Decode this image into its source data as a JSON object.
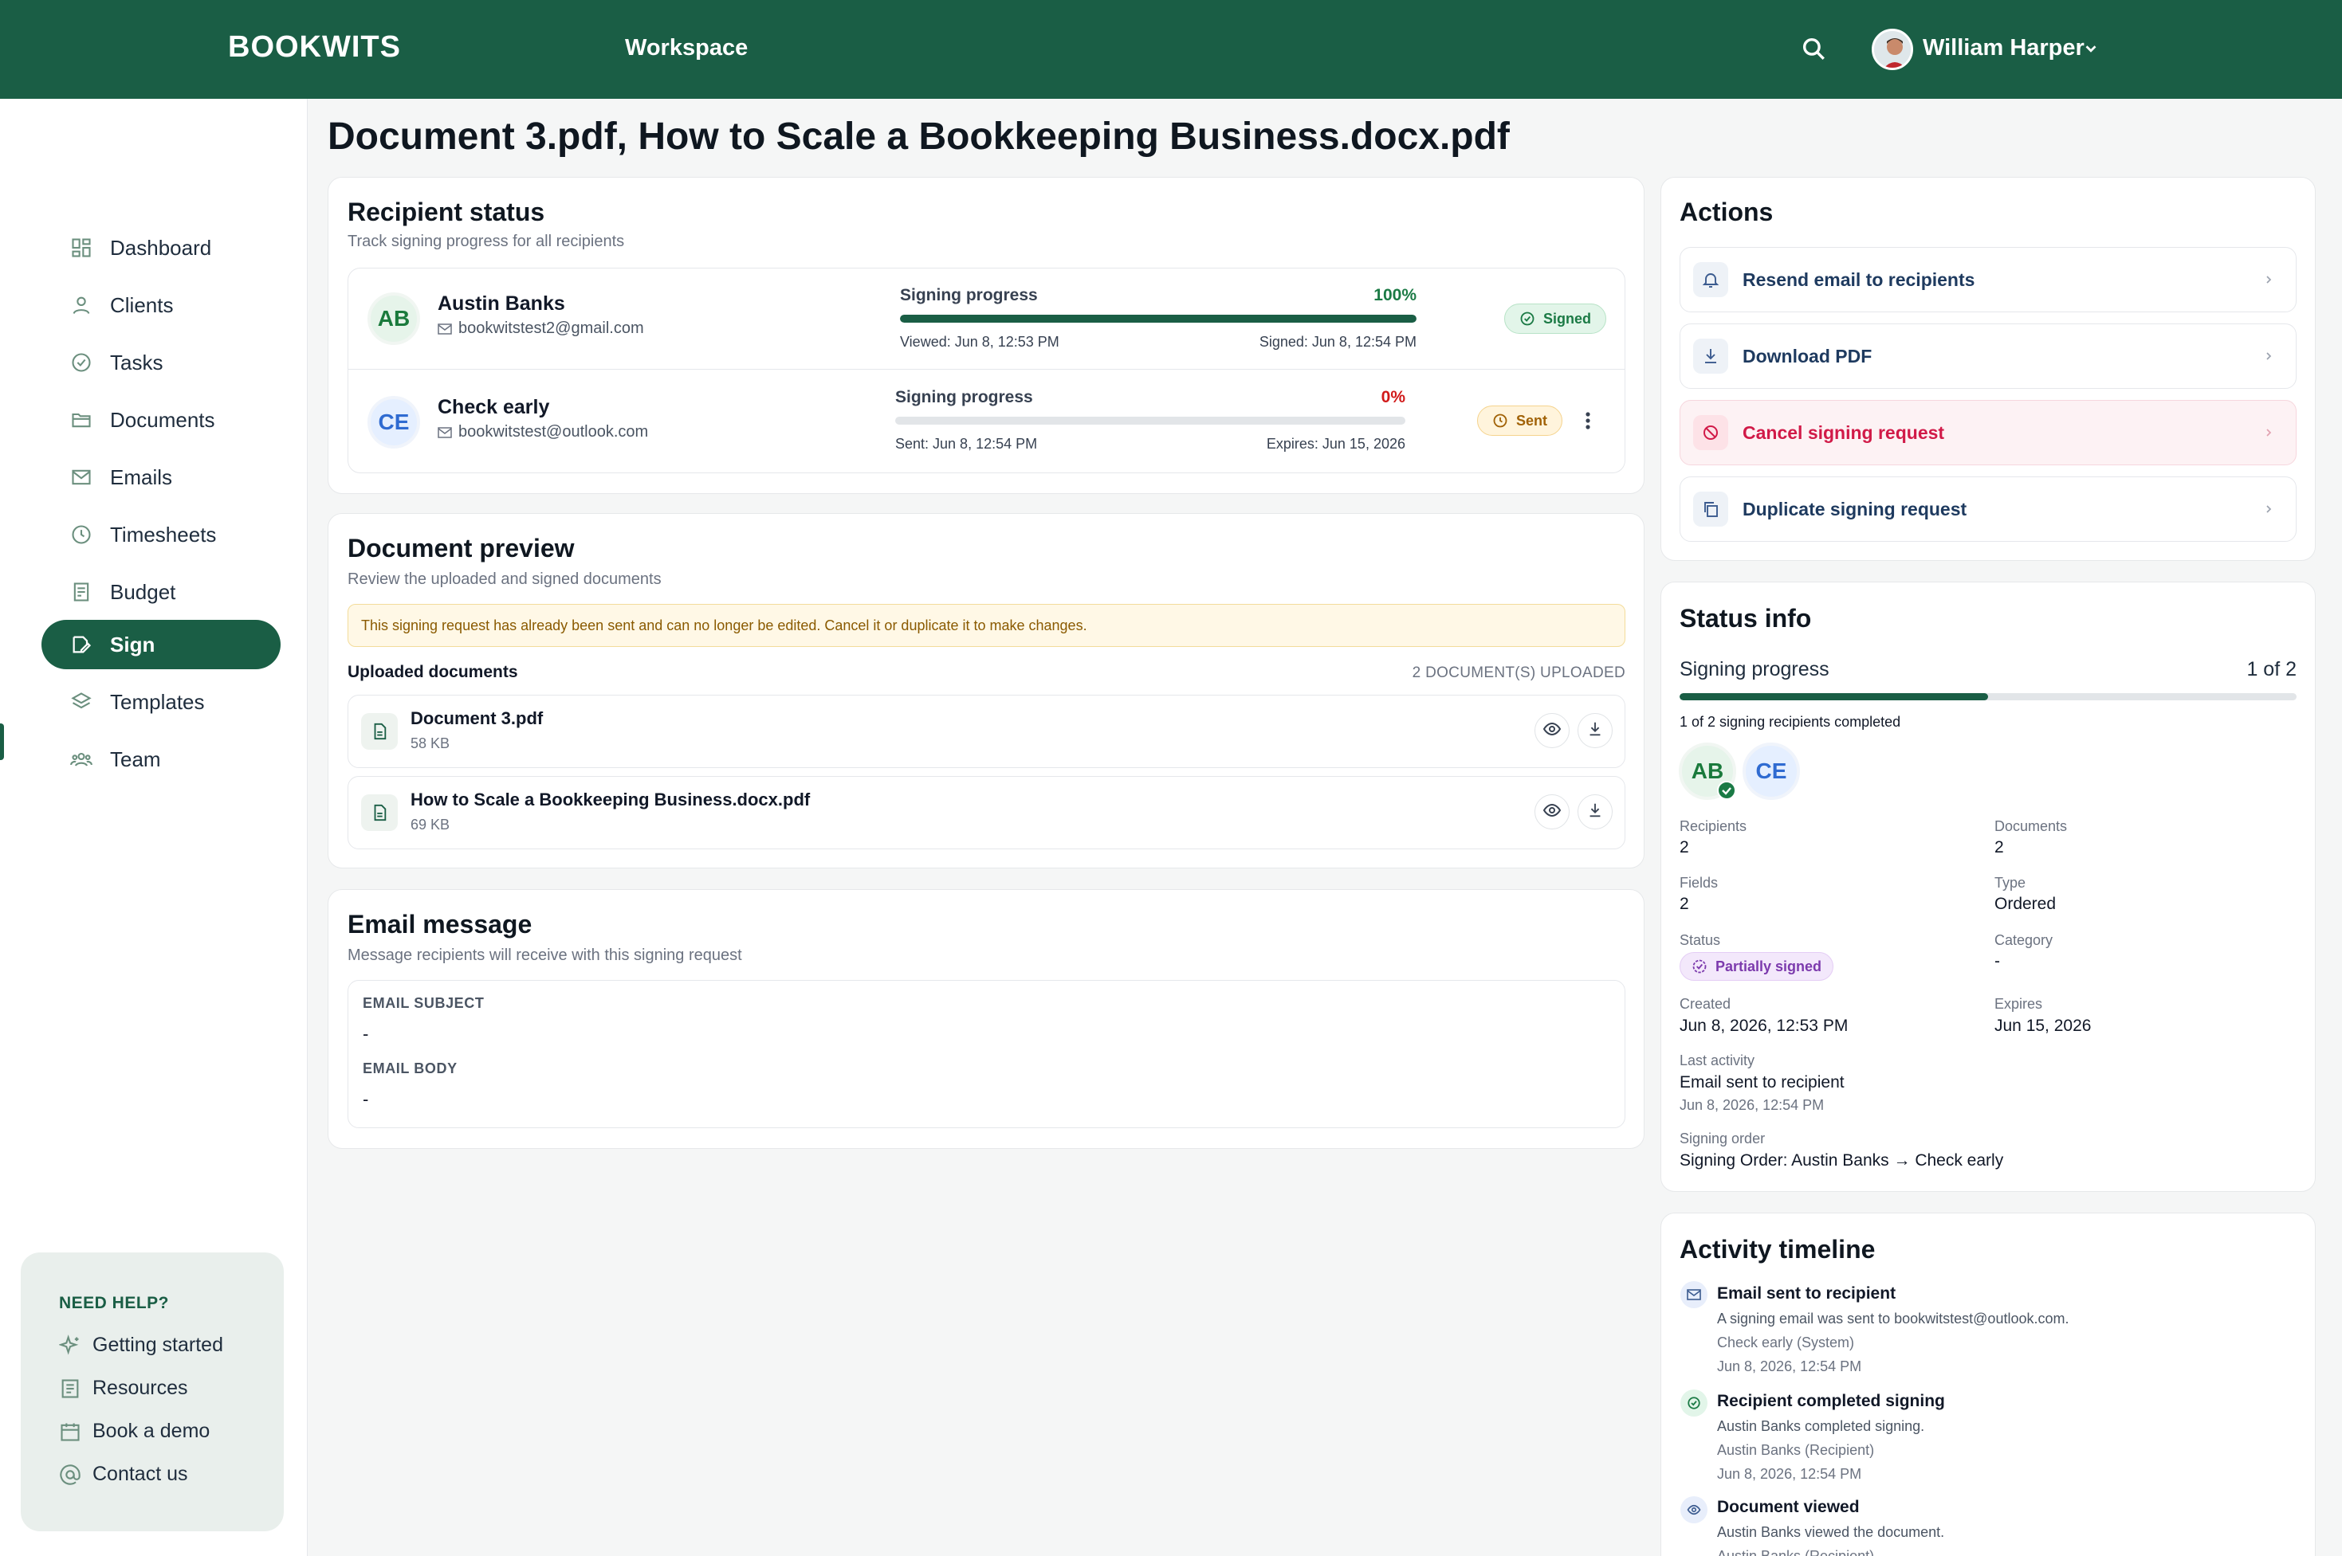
{
  "header": {
    "brand": "BOOKWITS",
    "workspace": "Workspace",
    "user_name": "William Harper"
  },
  "sidebar": {
    "items": [
      {
        "label": "Dashboard",
        "icon": "grid-icon"
      },
      {
        "label": "Clients",
        "icon": "user-icon"
      },
      {
        "label": "Tasks",
        "icon": "check-circle-icon"
      },
      {
        "label": "Documents",
        "icon": "folder-icon"
      },
      {
        "label": "Emails",
        "icon": "mail-icon"
      },
      {
        "label": "Timesheets",
        "icon": "clock-icon"
      },
      {
        "label": "Budget",
        "icon": "receipt-icon"
      },
      {
        "label": "Sign",
        "icon": "signature-icon",
        "active": true
      },
      {
        "label": "Templates",
        "icon": "layers-icon"
      },
      {
        "label": "Team",
        "icon": "team-icon"
      }
    ],
    "help": {
      "title": "NEED HELP?",
      "items": [
        {
          "label": "Getting started",
          "icon": "sparkle-icon"
        },
        {
          "label": "Resources",
          "icon": "book-icon"
        },
        {
          "label": "Book a demo",
          "icon": "calendar-icon"
        },
        {
          "label": "Contact us",
          "icon": "at-icon"
        }
      ]
    }
  },
  "page": {
    "title": "Document 3.pdf, How to Scale a Bookkeeping Business.docx.pdf"
  },
  "recipient_status": {
    "title": "Recipient status",
    "subtitle": "Track signing progress for all recipients",
    "recipients": [
      {
        "initials": "AB",
        "name": "Austin Banks",
        "email": "bookwitstest2@gmail.com",
        "progress_label": "Signing progress",
        "progress_text": "100%",
        "progress": 1.0,
        "meta_left": "Viewed: Jun 8, 12:53 PM",
        "meta_right": "Signed: Jun 8, 12:54 PM",
        "status": "Signed"
      },
      {
        "initials": "CE",
        "name": "Check early",
        "email": "bookwitstest@outlook.com",
        "progress_label": "Signing progress",
        "progress_text": "0%",
        "progress": 0.0,
        "meta_left": "Sent: Jun 8, 12:54 PM",
        "meta_right": "Expires: Jun 15, 2026",
        "status": "Sent"
      }
    ]
  },
  "document_preview": {
    "title": "Document preview",
    "subtitle": "Review the uploaded and signed documents",
    "notice": "This signing request has already been sent and can no longer be edited. Cancel it or duplicate it to make changes.",
    "uploaded_label": "Uploaded documents",
    "uploaded_count": "2 DOCUMENT(S) UPLOADED",
    "documents": [
      {
        "name": "Document 3.pdf",
        "size": "58 KB"
      },
      {
        "name": "How to Scale a Bookkeeping Business.docx.pdf",
        "size": "69 KB"
      }
    ]
  },
  "email_message": {
    "title": "Email message",
    "subtitle": "Message recipients will receive with this signing request",
    "subject_label": "EMAIL SUBJECT",
    "subject_value": "-",
    "body_label": "EMAIL BODY",
    "body_value": "-"
  },
  "actions": {
    "title": "Actions",
    "items": [
      {
        "label": "Resend email to recipients",
        "icon": "bell-icon"
      },
      {
        "label": "Download PDF",
        "icon": "download-icon"
      },
      {
        "label": "Cancel signing request",
        "icon": "ban-icon",
        "danger": true
      },
      {
        "label": "Duplicate signing request",
        "icon": "copy-icon"
      }
    ]
  },
  "status_info": {
    "title": "Status info",
    "progress_label": "Signing progress",
    "progress_count": "1 of 2",
    "progress": 0.5,
    "progress_note": "1 of 2 signing recipients completed",
    "avatars": [
      "AB",
      "CE"
    ],
    "fields": {
      "recipients_label": "Recipients",
      "recipients_value": "2",
      "documents_label": "Documents",
      "documents_value": "2",
      "fields_label": "Fields",
      "fields_value": "2",
      "type_label": "Type",
      "type_value": "Ordered",
      "status_label": "Status",
      "status_value": "Partially signed",
      "category_label": "Category",
      "category_value": "-",
      "created_label": "Created",
      "created_value": "Jun 8, 2026, 12:53 PM",
      "expires_label": "Expires",
      "expires_value": "Jun 15, 2026",
      "last_activity_label": "Last activity",
      "last_activity_value": "Email sent to recipient",
      "last_activity_time": "Jun 8, 2026, 12:54 PM",
      "signing_order_label": "Signing order",
      "signing_order_value": "Signing Order: Austin Banks → Check early"
    }
  },
  "activity": {
    "title": "Activity timeline",
    "events": [
      {
        "title": "Email sent to recipient",
        "line1": "A signing email was sent to bookwitstest@outlook.com.",
        "line2": "Check early (System)",
        "time": "Jun 8, 2026, 12:54 PM",
        "icon": "mail-icon"
      },
      {
        "title": "Recipient completed signing",
        "line1": "Austin Banks completed signing.",
        "line2": "Austin Banks (Recipient)",
        "time": "Jun 8, 2026, 12:54 PM",
        "icon": "check-circle-icon"
      },
      {
        "title": "Document viewed",
        "line1": "Austin Banks viewed the document.",
        "line2": "Austin Banks (Recipient)",
        "time": "",
        "icon": "eye-icon"
      }
    ]
  },
  "colors": {
    "brand": "#1a5e45",
    "danger": "#d11a48",
    "progress_pct_ok": "#1b7a45",
    "progress_pct_zero": "#d11a1a"
  }
}
